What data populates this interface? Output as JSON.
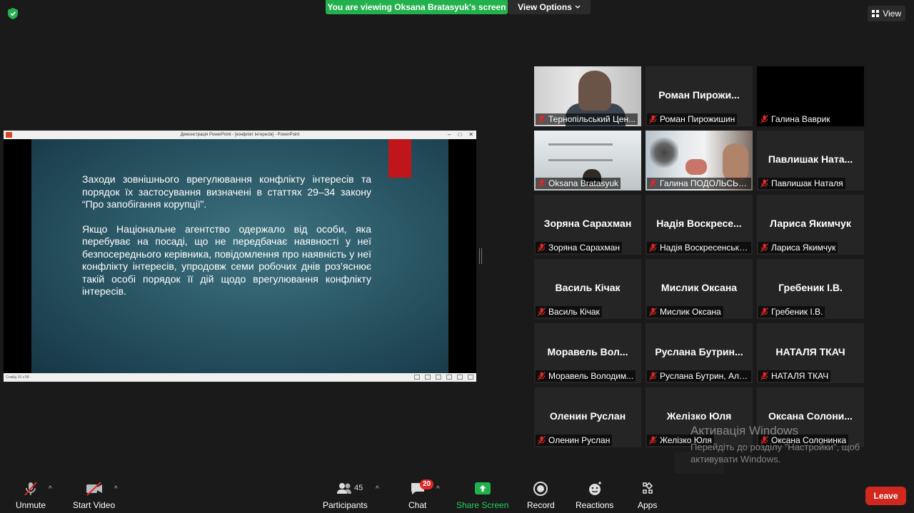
{
  "colors": {
    "banner_green": "#23b14d",
    "leave_red": "#d0281e",
    "active_border": "#d4e157",
    "background": "#1a1a1a",
    "tile_bg": "#252525"
  },
  "top": {
    "viewing_banner": "You are viewing Oksana Bratasyuk's screen",
    "view_options": "View Options",
    "view_button": "View"
  },
  "share": {
    "window_title": "Демонстрація PowerPoint - [конфлікт інтересів] - PowerPoint",
    "slide_paragraph_1": "Заходи зовнішнього врегулювання конфлікту інтересів та порядок їх застосування визначені в статтях 29–34 закону “Про запобігання корупції”.",
    "slide_paragraph_2": "Якщо Національне агентство одержало від особи, яка перебуває на посаді, що не передбачає наявності у неї безпосереднього керівника, повідомлення про наявність у неї конфлікту інтересів, упродовж семи робочих днів роз’яснює такій особі порядок її дій щодо врегулювання конфлікту інтересів.",
    "status_text": "Слайд 16 з 58"
  },
  "participants": [
    {
      "name": "",
      "label": "Тернопільський Цен...",
      "video": "man"
    },
    {
      "name": "Роман  Пирожи...",
      "label": "Роман Пирожишин",
      "video": ""
    },
    {
      "name": "",
      "label": "Галина Ваврик",
      "video": "black"
    },
    {
      "name": "",
      "label": "Oksana Bratasyuk",
      "video": "shelf",
      "active": true
    },
    {
      "name": "",
      "label": "Галина ПОДОЛЬСЬК...",
      "video": "window"
    },
    {
      "name": "Павлишак  Ната...",
      "label": "Павлишак Наталя",
      "video": ""
    },
    {
      "name": "Зоряна Сарахман",
      "label": "Зоряна Сарахман",
      "video": ""
    },
    {
      "name": "Надія  Воскресе...",
      "label": "Надія Воскресенська...",
      "video": ""
    },
    {
      "name": "Лариса Якимчук",
      "label": "Лариса Якимчук",
      "video": ""
    },
    {
      "name": "Василь Кічак",
      "label": "Василь Кічак",
      "video": ""
    },
    {
      "name": "Мислик Оксана",
      "label": "Мислик Оксана",
      "video": ""
    },
    {
      "name": "Гребеник І.В.",
      "label": "Гребеник І.В.",
      "video": ""
    },
    {
      "name": "Моравель  Вол...",
      "label": "Моравель Володим...",
      "video": ""
    },
    {
      "name": "Руслана  Бутрин...",
      "label": "Руслана Бутрин, Аль...",
      "video": ""
    },
    {
      "name": "НАТАЛЯ ТКАЧ",
      "label": "НАТАЛЯ ТКАЧ",
      "video": ""
    },
    {
      "name": "Оленин Руслан",
      "label": "Оленин Руслан",
      "video": ""
    },
    {
      "name": "Желізко Юля",
      "label": "Желізко Юля",
      "video": ""
    },
    {
      "name": "Оксана  Солони...",
      "label": "Оксана Солонинка",
      "video": ""
    }
  ],
  "watermark": {
    "title": "Активація Windows",
    "subtitle": "Перейдіть до розділу \"Настройки\", щоб активувати Windows."
  },
  "toolbar": {
    "unmute": "Unmute",
    "start_video": "Start Video",
    "participants": "Participants",
    "participants_count": "45",
    "chat": "Chat",
    "chat_badge": "20",
    "share_screen": "Share Screen",
    "record": "Record",
    "reactions": "Reactions",
    "apps": "Apps",
    "leave": "Leave"
  }
}
